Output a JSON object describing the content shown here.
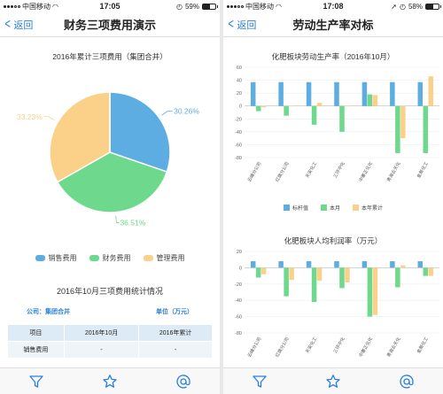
{
  "left": {
    "status": {
      "carrier": "中国移动",
      "time": "17:05",
      "battery": "59%"
    },
    "nav": {
      "back": "返回",
      "title": "财务三项费用演示"
    },
    "pie": {
      "title": "2016年累计三项费用（集团合并）",
      "labels": [
        "30.26%",
        "36.51%",
        "33.23%"
      ]
    },
    "legend": [
      "销售费用",
      "财务费用",
      "管理费用"
    ],
    "stats": {
      "title": "2016年10月三项费用统计情况",
      "company": "公司：集团合并",
      "unit": "单位（万元）",
      "headers": [
        "项目",
        "2016年10月",
        "2016年累计"
      ],
      "row": [
        "销售费用",
        "-",
        "-"
      ]
    }
  },
  "right": {
    "status": {
      "time": "17:08",
      "battery": "58%"
    },
    "nav": {
      "back": "返回",
      "title": "劳动生产率对标"
    },
    "chart1_title": "化肥板块劳动生产率（2016年10月）",
    "chart2_title": "化肥板块人均利润率（万元）",
    "chart_legend": [
      "标杆值",
      "本月",
      "本年累计"
    ]
  },
  "colors": {
    "blue": "#5dade2",
    "green": "#6ed88c",
    "yellow": "#fbd18a",
    "accent": "#2a7ee0"
  },
  "chart_data": [
    {
      "type": "pie",
      "title": "2016年累计三项费用（集团合并）",
      "labels": [
        "销售费用",
        "财务费用",
        "管理费用"
      ],
      "values": [
        30.26,
        36.51,
        33.23
      ]
    },
    {
      "type": "bar",
      "title": "化肥板块劳动生产率（2016年10月）",
      "categories": [
        "云峰分公司",
        "红旗分公司",
        "天安化工",
        "三环中化",
        "中寨正化化",
        "青海云天化",
        "金新化工"
      ],
      "ylim": [
        -80,
        60
      ],
      "yticks": [
        60,
        40,
        20,
        0,
        -20,
        -40,
        -60,
        -80
      ],
      "series": [
        {
          "name": "标杆值",
          "values": [
            37,
            37,
            37,
            37,
            37,
            37,
            37
          ]
        },
        {
          "name": "本月",
          "values": [
            -8,
            -15,
            -29,
            -40,
            18,
            -73,
            -73
          ]
        },
        {
          "name": "本年累计",
          "values": [
            -2,
            0,
            5,
            0,
            17,
            -50,
            46
          ]
        }
      ]
    },
    {
      "type": "bar",
      "title": "化肥板块人均利润率（万元）",
      "categories": [
        "云峰分公司",
        "红旗分公司",
        "天安化工",
        "三环中化",
        "中寨正化化",
        "青海云天化",
        "金新化工"
      ],
      "ylim": [
        -80,
        20
      ],
      "yticks": [
        20,
        0,
        -20,
        -40,
        -60,
        -80
      ],
      "series": [
        {
          "name": "标杆值",
          "values": [
            8,
            8,
            8,
            8,
            8,
            8,
            8
          ]
        },
        {
          "name": "本月",
          "values": [
            -12,
            -35,
            -42,
            -25,
            -60,
            -24,
            -10
          ]
        },
        {
          "name": "本年累计",
          "values": [
            -8,
            -15,
            -16,
            -18,
            -58,
            3,
            -10
          ]
        }
      ]
    }
  ]
}
